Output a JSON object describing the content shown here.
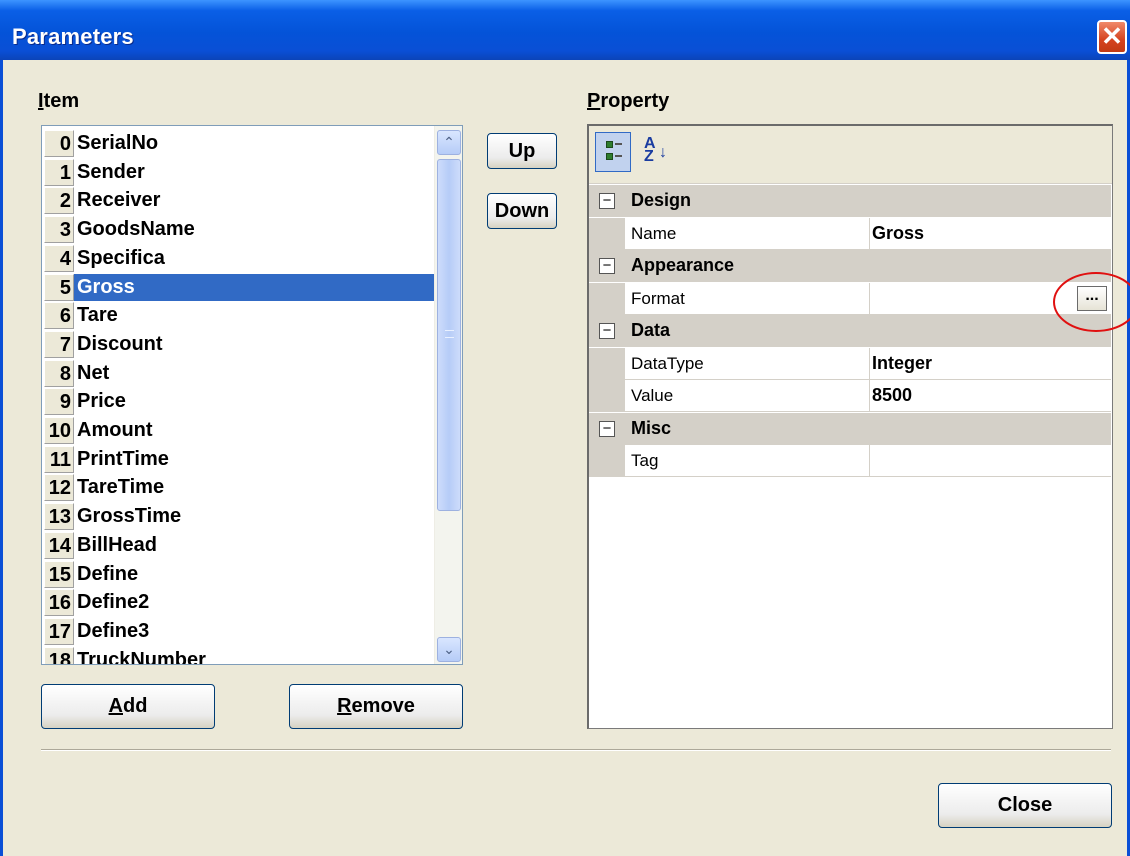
{
  "window": {
    "title": "Parameters",
    "close_glyph": "✕"
  },
  "item_label": {
    "prefix": "",
    "accel": "I",
    "rest": "tem"
  },
  "property_label": {
    "accel": "P",
    "rest": "roperty"
  },
  "items": [
    {
      "idx": "0",
      "name": "SerialNo"
    },
    {
      "idx": "1",
      "name": "Sender"
    },
    {
      "idx": "2",
      "name": "Receiver"
    },
    {
      "idx": "3",
      "name": "GoodsName"
    },
    {
      "idx": "4",
      "name": "Specifica"
    },
    {
      "idx": "5",
      "name": "Gross",
      "selected": true
    },
    {
      "idx": "6",
      "name": "Tare"
    },
    {
      "idx": "7",
      "name": "Discount"
    },
    {
      "idx": "8",
      "name": "Net"
    },
    {
      "idx": "9",
      "name": "Price"
    },
    {
      "idx": "10",
      "name": "Amount"
    },
    {
      "idx": "11",
      "name": "PrintTime"
    },
    {
      "idx": "12",
      "name": "TareTime"
    },
    {
      "idx": "13",
      "name": "GrossTime"
    },
    {
      "idx": "14",
      "name": "BillHead"
    },
    {
      "idx": "15",
      "name": "Define"
    },
    {
      "idx": "16",
      "name": "Define2"
    },
    {
      "idx": "17",
      "name": "Define3"
    },
    {
      "idx": "18",
      "name": "TruckNumber"
    }
  ],
  "scrollbar": {
    "up_glyph": "⌃",
    "down_glyph": "⌄"
  },
  "buttons": {
    "up": "Up",
    "down": "Down",
    "add_accel": "A",
    "add_rest": "dd",
    "remove_accel": "R",
    "remove_rest": "emove",
    "close": "Close",
    "ellipsis": "..."
  },
  "toolbar": {
    "categorized_icon": "categorized-icon",
    "alphabetical_icon": "sort-az-icon",
    "az_a": "A",
    "az_z": "Z",
    "az_arrow": "↓"
  },
  "property_grid": {
    "toggle_glyph": "−",
    "categories": [
      {
        "name": "Design",
        "props": [
          {
            "name": "Name",
            "value": "Gross"
          }
        ]
      },
      {
        "name": "Appearance",
        "props": [
          {
            "name": "Format",
            "value": "",
            "has_button": true
          }
        ]
      },
      {
        "name": "Data",
        "props": [
          {
            "name": "DataType",
            "value": "Integer"
          },
          {
            "name": "Value",
            "value": "8500"
          }
        ]
      },
      {
        "name": "Misc",
        "props": [
          {
            "name": "Tag",
            "value": ""
          }
        ]
      }
    ]
  }
}
